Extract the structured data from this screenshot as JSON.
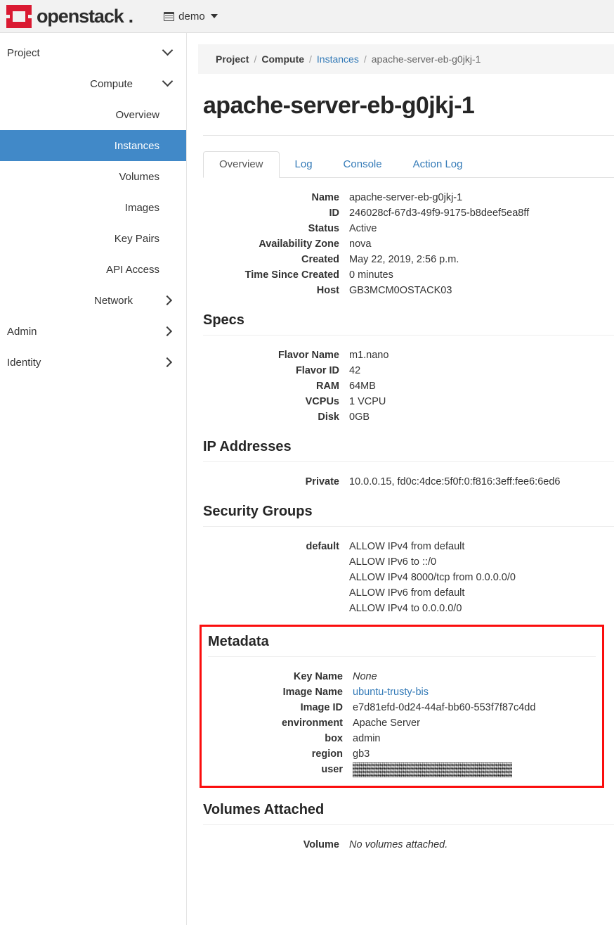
{
  "navbar": {
    "brand": "openstack",
    "brand_suffix": ".",
    "tenant": "demo",
    "logo_icon": "openstack-logo-icon",
    "tenant_icon": "project-list-icon",
    "caret_icon": "caret-down-icon"
  },
  "sidebar": {
    "items": [
      {
        "label": "Project",
        "level": 1,
        "chevron": "chevron-down-icon",
        "active": false
      },
      {
        "label": "Compute",
        "level": 2,
        "chevron": "chevron-down-icon",
        "active": false
      },
      {
        "label": "Overview",
        "level": 3,
        "chevron": "",
        "active": false
      },
      {
        "label": "Instances",
        "level": 3,
        "chevron": "",
        "active": true
      },
      {
        "label": "Volumes",
        "level": 3,
        "chevron": "",
        "active": false
      },
      {
        "label": "Images",
        "level": 3,
        "chevron": "",
        "active": false
      },
      {
        "label": "Key Pairs",
        "level": 3,
        "chevron": "",
        "active": false
      },
      {
        "label": "API Access",
        "level": 3,
        "chevron": "",
        "active": false
      },
      {
        "label": "Network",
        "level": 2,
        "chevron": "chevron-right-icon",
        "active": false
      },
      {
        "label": "Admin",
        "level": 1,
        "chevron": "chevron-right-icon",
        "active": false
      },
      {
        "label": "Identity",
        "level": 1,
        "chevron": "chevron-right-icon",
        "active": false
      }
    ]
  },
  "breadcrumb": {
    "items": [
      "Project",
      "Compute",
      "Instances",
      "apache-server-eb-g0jkj-1"
    ],
    "separator": "/"
  },
  "page": {
    "title": "apache-server-eb-g0jkj-1"
  },
  "tabs": [
    {
      "label": "Overview",
      "active": true
    },
    {
      "label": "Log",
      "active": false
    },
    {
      "label": "Console",
      "active": false
    },
    {
      "label": "Action Log",
      "active": false
    }
  ],
  "overview": {
    "rows": [
      {
        "term": "Name",
        "value": "apache-server-eb-g0jkj-1"
      },
      {
        "term": "ID",
        "value": "246028cf-67d3-49f9-9175-b8deef5ea8ff"
      },
      {
        "term": "Status",
        "value": "Active"
      },
      {
        "term": "Availability Zone",
        "value": "nova"
      },
      {
        "term": "Created",
        "value": "May 22, 2019, 2:56 p.m."
      },
      {
        "term": "Time Since Created",
        "value": "0 minutes"
      },
      {
        "term": "Host",
        "value": "GB3MCM0OSTACK03"
      }
    ]
  },
  "specs": {
    "heading": "Specs",
    "rows": [
      {
        "term": "Flavor Name",
        "value": "m1.nano"
      },
      {
        "term": "Flavor ID",
        "value": "42"
      },
      {
        "term": "RAM",
        "value": "64MB"
      },
      {
        "term": "VCPUs",
        "value": "1 VCPU"
      },
      {
        "term": "Disk",
        "value": "0GB"
      }
    ]
  },
  "ip_addresses": {
    "heading": "IP Addresses",
    "rows": [
      {
        "term": "Private",
        "value": "10.0.0.15,  fd0c:4dce:5f0f:0:f816:3eff:fee6:6ed6"
      }
    ]
  },
  "security_groups": {
    "heading": "Security Groups",
    "term": "default",
    "rules": [
      "ALLOW IPv4 from default",
      "ALLOW IPv6 to ::/0",
      "ALLOW IPv4 8000/tcp from 0.0.0.0/0",
      "ALLOW IPv6 from default",
      "ALLOW IPv4 to 0.0.0.0/0"
    ]
  },
  "metadata": {
    "heading": "Metadata",
    "highlight_color": "#fb0d0d",
    "rows": [
      {
        "term": "Key Name",
        "value": "None",
        "style": "italic"
      },
      {
        "term": "Image Name",
        "value": "ubuntu-trusty-bis",
        "style": "link"
      },
      {
        "term": "Image ID",
        "value": "e7d81efd-0d24-44af-bb60-553f7f87c4dd",
        "style": "plain"
      },
      {
        "term": "environment",
        "value": "Apache Server",
        "style": "plain"
      },
      {
        "term": "box",
        "value": "admin",
        "style": "plain"
      },
      {
        "term": "region",
        "value": "gb3",
        "style": "plain"
      },
      {
        "term": "user",
        "value": "",
        "style": "redacted"
      }
    ]
  },
  "volumes_attached": {
    "heading": "Volumes Attached",
    "rows": [
      {
        "term": "Volume",
        "value": "No volumes attached."
      }
    ]
  },
  "colors": {
    "sidebar_active": "#4189c8",
    "link": "#337ab7",
    "brand_red": "#da1a32",
    "highlight_red": "#fb0d0d"
  }
}
